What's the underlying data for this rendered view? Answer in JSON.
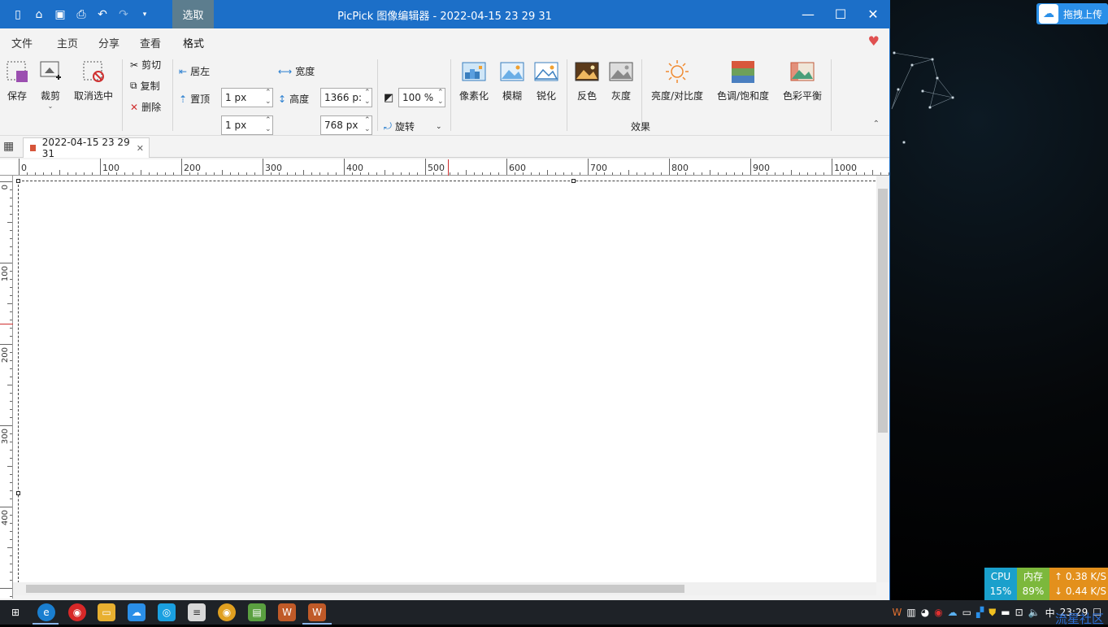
{
  "window": {
    "title": "PicPick 图像编辑器 - 2022-04-15 23 29 31",
    "context_tab": "选取"
  },
  "tabs": [
    "文件",
    "主页",
    "分享",
    "查看",
    "格式"
  ],
  "ribbon": {
    "save": "保存",
    "crop": "裁剪",
    "deselect": "取消选中",
    "cut": "剪切",
    "copy": "复制",
    "delete": "删除",
    "align_left": "居左",
    "align_top": "置顶",
    "left_val": "1 px",
    "top_val": "1 px",
    "width_label": "宽度",
    "height_label": "高度",
    "width_val": "1366 p:",
    "height_val": "768 px",
    "zoom_val": "100 %",
    "rotate": "旋转",
    "pixelate": "像素化",
    "blur": "模糊",
    "sharpen": "锐化",
    "invert": "反色",
    "gray": "灰度",
    "brightness": "亮度/对比度",
    "hue": "色调/饱和度",
    "balance": "色彩平衡",
    "effects_group": "效果"
  },
  "document_tab": {
    "name": "2022-04-15 23 29 31"
  },
  "hruler_labels": [
    "0",
    "100",
    "200",
    "300",
    "400",
    "500",
    "600",
    "700",
    "800",
    "900",
    "1000"
  ],
  "vruler_labels": [
    "0",
    "100",
    "200",
    "300",
    "400"
  ],
  "desktop": {
    "upload": "拖拽上传",
    "watermark": "流星社区"
  },
  "netmon": {
    "cpu_label": "CPU",
    "cpu_val": "15%",
    "mem_label": "内存",
    "mem_val": "89%",
    "up": "0.38 K/S",
    "down": "0.44 K/S"
  },
  "tray": {
    "ime": "中",
    "time": "23:29"
  }
}
